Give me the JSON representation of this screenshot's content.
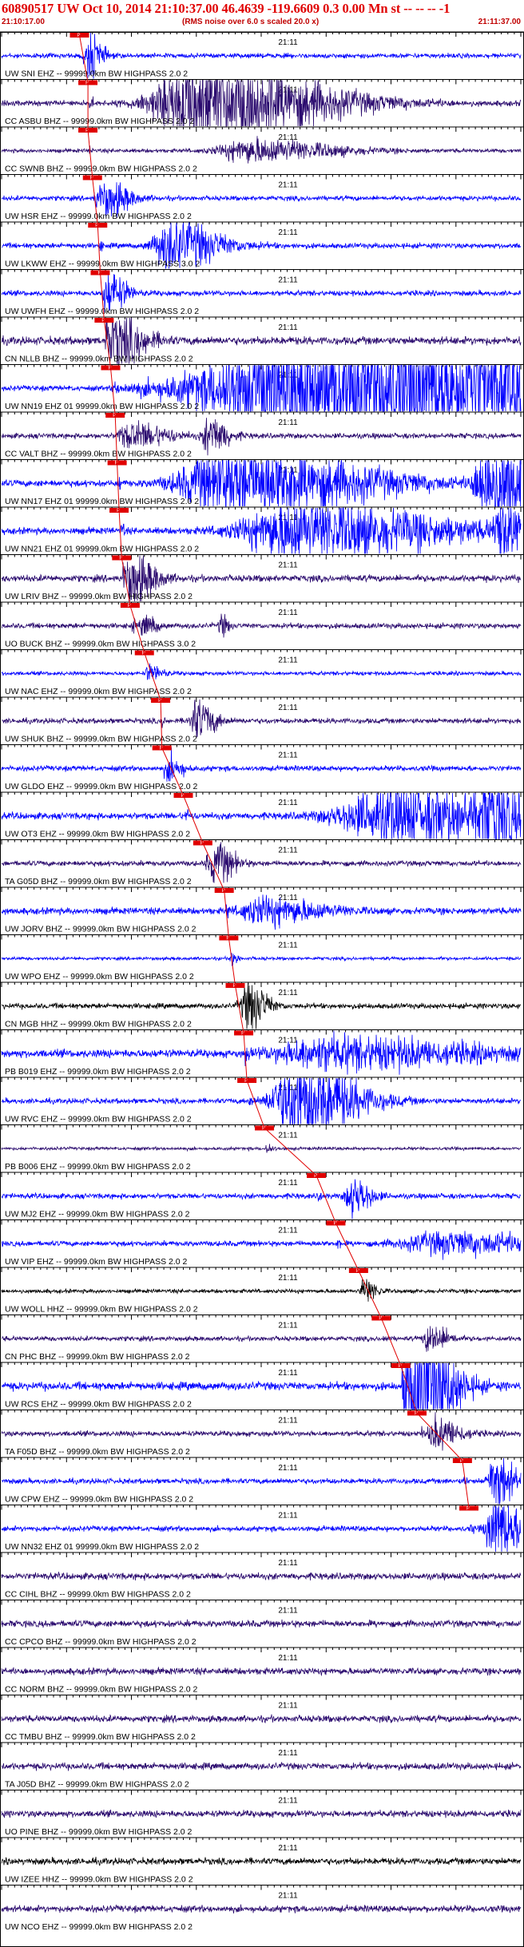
{
  "header": {
    "title": "60890517 UW Oct 10, 2014 21:10:37.00  46.4639 -119.6609  0.3 0.00 Mn st -- -- --  -1",
    "start_time": "21:10:17.00",
    "noise_note": "(RMS noise over 6.0 s scaled 20.0 x)",
    "end_time": "21:11:37.00"
  },
  "colors": {
    "title": "#e00000",
    "trace_blue": "#0000ff",
    "trace_purple": "#2a0a6e",
    "trace_black": "#000000",
    "pick": "#e00000",
    "grid": "#000000"
  },
  "chart_data": {
    "type": "line",
    "x_axis": {
      "start": "21:10:17.00",
      "end": "21:11:37.00",
      "unit": "s",
      "range": [
        0,
        80
      ],
      "minor_tick_s": 1,
      "major_tick_s": 10,
      "center_label": "21:11",
      "center_label_time_s": 43
    },
    "pick_label": "P",
    "series": [
      {
        "name": "UW SNI EHZ -- 99999.0km BW  HIGHPASS  2.0  2",
        "color": "#0000ff",
        "pick_s": 12.0,
        "amp": 1.8,
        "onset_s": 12.2,
        "burst": [
          [
            13.5,
            10.0,
            2.0
          ]
        ],
        "decay": 2.5
      },
      {
        "name": "CC ASBU BHZ -- 99999.0km BW  HIGHPASS  2.0  2",
        "color": "#2a0a6e",
        "pick_s": 13.3,
        "amp": 2.0,
        "onset_s": 13.5,
        "burst": [
          [
            30,
            18,
            20
          ]
        ],
        "decay": 0.4
      },
      {
        "name": "CC SWNB BHZ -- 99999.0km BW  HIGHPASS  2.0  2",
        "color": "#2a0a6e",
        "pick_s": 13.3,
        "amp": 1.5,
        "onset_s": 13.5,
        "burst": [
          [
            38,
            6,
            14
          ]
        ],
        "decay": 0.8
      },
      {
        "name": "UW HSR EHZ -- 99999.0km BW  HIGHPASS  2.0  2",
        "color": "#0000ff",
        "pick_s": 14.0,
        "amp": 1.8,
        "onset_s": 14.2,
        "burst": [
          [
            16,
            8,
            4
          ]
        ],
        "decay": 1.2
      },
      {
        "name": "UW LKWW EHZ -- 99999.0km BW  HIGHPASS  3.0  2",
        "color": "#0000ff",
        "pick_s": 14.8,
        "amp": 2.0,
        "onset_s": 15.0,
        "burst": [
          [
            26,
            10,
            8
          ]
        ],
        "decay": 0.8
      },
      {
        "name": "UW UWFH EHZ -- 99999.0km BW  HIGHPASS  2.0  2",
        "color": "#0000ff",
        "pick_s": 15.2,
        "amp": 2.0,
        "onset_s": 15.4,
        "burst": [
          [
            16.5,
            8,
            3
          ]
        ],
        "decay": 1.5
      },
      {
        "name": "CN NLLB BHZ -- 99999.0km BW  HIGHPASS  2.0  2",
        "color": "#2a0a6e",
        "pick_s": 15.8,
        "amp": 3.0,
        "onset_s": 16.0,
        "burst": [
          [
            17,
            8,
            5
          ]
        ],
        "decay": 0.8
      },
      {
        "name": "UW NN19 EHZ 01 99999.0km BW  HIGHPASS  2.0  2",
        "color": "#0000ff",
        "pick_s": 16.8,
        "amp": 2.0,
        "onset_s": 17.0,
        "burst": [
          [
            50,
            25,
            60
          ]
        ],
        "decay": 0.0
      },
      {
        "name": "CC VALT BHZ -- 99999.0km BW  HIGHPASS  2.0  2",
        "color": "#2a0a6e",
        "pick_s": 17.5,
        "amp": 2.0,
        "onset_s": 17.7,
        "burst": [
          [
            32,
            8,
            3
          ],
          [
            20,
            5,
            6
          ]
        ],
        "decay": 0.6
      },
      {
        "name": "UW NN17 EHZ 01 99999.0km BW  HIGHPASS  2.0  2",
        "color": "#0000ff",
        "pick_s": 17.8,
        "amp": 2.5,
        "onset_s": 18.0,
        "burst": [
          [
            35,
            12,
            22
          ],
          [
            75,
            16,
            6
          ]
        ],
        "decay": 0.2
      },
      {
        "name": "UW NN21 EHZ 01 99999.0km BW  HIGHPASS  2.0  2",
        "color": "#0000ff",
        "pick_s": 18.1,
        "amp": 2.5,
        "onset_s": 18.3,
        "burst": [
          [
            45,
            9,
            25
          ],
          [
            77,
            10,
            3
          ]
        ],
        "decay": 0.2
      },
      {
        "name": "UW LRIV BHZ -- 99999.0km BW  HIGHPASS  2.0  2",
        "color": "#2a0a6e",
        "pick_s": 18.5,
        "amp": 2.5,
        "onset_s": 18.7,
        "burst": [
          [
            20,
            8,
            4
          ]
        ],
        "decay": 1.2
      },
      {
        "name": "UO BUCK BHZ -- 99999.0km BW  HIGHPASS  3.0  2",
        "color": "#2a0a6e",
        "pick_s": 19.8,
        "amp": 2.0,
        "onset_s": 20.0,
        "burst": [
          [
            22,
            4,
            2
          ],
          [
            34,
            4,
            1
          ]
        ],
        "decay": 1.5
      },
      {
        "name": "UW NAC EHZ -- 99999.0km BW  HIGHPASS  2.0  2",
        "color": "#0000ff",
        "pick_s": 22.0,
        "amp": 1.5,
        "onset_s": 22.2,
        "burst": [
          [
            23,
            4,
            2
          ]
        ],
        "decay": 1.5
      },
      {
        "name": "UW SHUK BHZ -- 99999.0km BW  HIGHPASS  2.0  2",
        "color": "#2a0a6e",
        "pick_s": 24.5,
        "amp": 2.0,
        "onset_s": 24.7,
        "burst": [
          [
            30,
            8,
            3
          ]
        ],
        "decay": 1.0
      },
      {
        "name": "UW GLDO EHZ -- 99999.0km BW  HIGHPASS  2.0  2",
        "color": "#0000ff",
        "pick_s": 24.7,
        "amp": 2.0,
        "onset_s": 25.0,
        "burst": [
          [
            26,
            5,
            2
          ]
        ],
        "decay": 1.5
      },
      {
        "name": "UW OT3 EHZ -- 99999.0km BW  HIGHPASS  2.0  2",
        "color": "#0000ff",
        "pick_s": 28.0,
        "amp": 2.5,
        "onset_s": 28.2,
        "burst": [
          [
            60,
            9,
            25
          ],
          [
            75,
            8,
            4
          ]
        ],
        "decay": 0.2
      },
      {
        "name": "TA G05D BHZ -- 99999.0km BW  HIGHPASS  2.0  2",
        "color": "#2a0a6e",
        "pick_s": 31.0,
        "amp": 2.0,
        "onset_s": 31.2,
        "burst": [
          [
            33,
            8,
            3
          ]
        ],
        "decay": 1.2
      },
      {
        "name": "UW JORV BHZ -- 99999.0km BW  HIGHPASS  2.0  2",
        "color": "#0000ff",
        "pick_s": 34.3,
        "amp": 2.5,
        "onset_s": 34.5,
        "burst": [
          [
            40,
            4,
            10
          ]
        ],
        "decay": 0.4
      },
      {
        "name": "UW WPO EHZ -- 99999.0km BW  HIGHPASS  2.0  2",
        "color": "#0000ff",
        "pick_s": 35.0,
        "amp": 1.2,
        "onset_s": 35.2,
        "burst": [
          [
            35.5,
            4,
            1
          ]
        ],
        "decay": 2.0
      },
      {
        "name": "CN MGB HHZ -- 99999.0km BW  HIGHPASS  2.0  2",
        "color": "#000000",
        "pick_s": 36.0,
        "amp": 2.0,
        "onset_s": 36.2,
        "burst": [
          [
            38,
            10,
            3
          ]
        ],
        "decay": 0.8
      },
      {
        "name": "PB B019 EHZ -- 99999.0km BW  HIGHPASS  2.0  2",
        "color": "#0000ff",
        "pick_s": 37.3,
        "amp": 3.0,
        "onset_s": 37.5,
        "burst": [
          [
            50,
            4,
            25
          ]
        ],
        "decay": 0.1
      },
      {
        "name": "UW RVC EHZ -- 99999.0km BW  HIGHPASS  2.0  2",
        "color": "#0000ff",
        "pick_s": 37.8,
        "amp": 2.0,
        "onset_s": 38.0,
        "burst": [
          [
            45,
            18,
            10
          ]
        ],
        "decay": 0.4
      },
      {
        "name": "PB B006 EHZ -- 99999.0km BW  HIGHPASS  2.0  2",
        "color": "#2a0a6e",
        "pick_s": 40.5,
        "amp": 1.2,
        "onset_s": 40.7,
        "burst": [
          [
            41,
            2,
            1
          ]
        ],
        "decay": 1.5
      },
      {
        "name": "UW MJ2 EHZ -- 99999.0km BW  HIGHPASS  2.0  2",
        "color": "#0000ff",
        "pick_s": 48.5,
        "amp": 2.0,
        "onset_s": 48.7,
        "burst": [
          [
            54,
            8,
            3
          ]
        ],
        "decay": 0.8
      },
      {
        "name": "UW VIP EHZ -- 99999.0km BW  HIGHPASS  2.0  2",
        "color": "#0000ff",
        "pick_s": 51.5,
        "amp": 2.0,
        "onset_s": 51.7,
        "burst": [
          [
            68,
            4,
            20
          ]
        ],
        "decay": 0.2
      },
      {
        "name": "UW WOLL HHZ -- 99999.0km BW  HIGHPASS  2.0  2",
        "color": "#000000",
        "pick_s": 55.0,
        "amp": 1.5,
        "onset_s": 55.2,
        "burst": [
          [
            56,
            6,
            2
          ]
        ],
        "decay": 1.0
      },
      {
        "name": "CN PHC BHZ -- 99999.0km BW  HIGHPASS  2.0  2",
        "color": "#2a0a6e",
        "pick_s": 58.5,
        "amp": 1.8,
        "onset_s": 58.7,
        "burst": [
          [
            66,
            6,
            3
          ],
          [
            27,
            5,
            2
          ]
        ],
        "decay": 0.8
      },
      {
        "name": "UW RCS EHZ -- 99999.0km BW  HIGHPASS  2.0  2",
        "color": "#0000ff",
        "pick_s": 61.5,
        "amp": 3.0,
        "onset_s": 61.7,
        "burst": [
          [
            64,
            18,
            6
          ]
        ],
        "decay": 0.6
      },
      {
        "name": "TA F05D BHZ -- 99999.0km BW  HIGHPASS  2.0  2",
        "color": "#2a0a6e",
        "pick_s": 64.0,
        "amp": 2.0,
        "onset_s": 64.2,
        "burst": [
          [
            67,
            6,
            4
          ]
        ],
        "decay": 0.8
      },
      {
        "name": "UW CPW EHZ -- 99999.0km BW  HIGHPASS  2.0  2",
        "color": "#0000ff",
        "pick_s": 71.0,
        "amp": 2.0,
        "onset_s": 71.2,
        "burst": [
          [
            76,
            12,
            3
          ]
        ],
        "decay": 0.6
      },
      {
        "name": "UW NN32 EHZ 01 99999.0km BW  HIGHPASS  2.0  2",
        "color": "#0000ff",
        "pick_s": 72.0,
        "amp": 2.0,
        "onset_s": 72.2,
        "burst": [
          [
            76,
            14,
            4
          ]
        ],
        "decay": 0.6
      },
      {
        "name": "CC CIHL BHZ -- 99999.0km BW  HIGHPASS  2.0  2",
        "color": "#2a0a6e",
        "pick_s": null,
        "amp": 2.5
      },
      {
        "name": "CC CPCO BHZ -- 99999.0km BW  HIGHPASS  2.0  2",
        "color": "#2a0a6e",
        "pick_s": null,
        "amp": 2.5
      },
      {
        "name": "CC NORM BHZ -- 99999.0km BW  HIGHPASS  2.0  2",
        "color": "#2a0a6e",
        "pick_s": null,
        "amp": 2.5
      },
      {
        "name": "CC TMBU BHZ -- 99999.0km BW  HIGHPASS  2.0  2",
        "color": "#2a0a6e",
        "pick_s": null,
        "amp": 2.5
      },
      {
        "name": "TA J05D BHZ -- 99999.0km BW  HIGHPASS  2.0  2",
        "color": "#2a0a6e",
        "pick_s": null,
        "amp": 2.5
      },
      {
        "name": "UO PINE BHZ -- 99999.0km BW  HIGHPASS  2.0  2",
        "color": "#2a0a6e",
        "pick_s": null,
        "amp": 2.5
      },
      {
        "name": "UW IZEE HHZ -- 99999.0km BW  HIGHPASS  2.0  2",
        "color": "#000000",
        "pick_s": null,
        "amp": 2.5
      },
      {
        "name": "UW NCO EHZ -- 99999.0km BW  HIGHPASS  2.0  2",
        "color": "#2a0a6e",
        "pick_s": null,
        "amp": 2.5
      }
    ]
  }
}
